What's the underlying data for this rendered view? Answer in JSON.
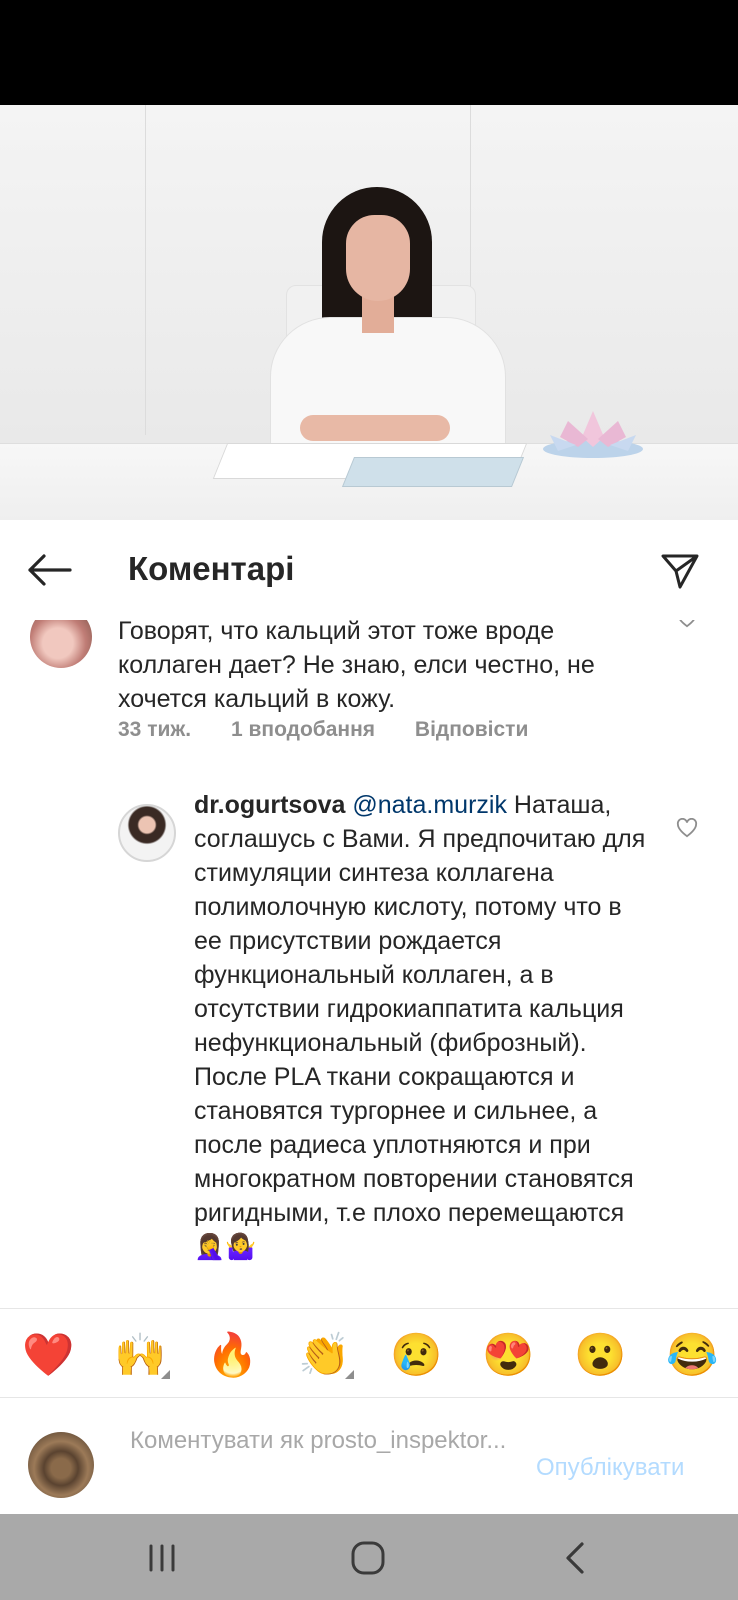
{
  "header": {
    "title": "Коментарі"
  },
  "comments": [
    {
      "text": "Говорят, что кальций этот тоже вроде коллаген дает? Не знаю, елси честно, не хочется кальций в кожу.",
      "time": "33 тиж.",
      "likes": "1 вподобання",
      "reply_label": "Відповісти"
    }
  ],
  "reply": {
    "username": "dr.ogurtsova",
    "mention": "@nata.murzik",
    "text": "Наташа, соглашусь с Вами. Я предпочитаю для стимуляции синтеза коллагена полимолочную кислоту, потому что в ее присутствии рождается функциональный коллаген, а в отсутствии гидрокиаппатита кальция нефункциональный (фиброзный). После PLA ткани сокращаются и становятся тургорнее и сильнее, а после радиеса уплотняются и при многократном повторении становятся ригидными, т.е плохо перемещаются🤦‍♀️🤷‍♀️"
  },
  "emoji_bar": [
    "❤️",
    "🙌",
    "🔥",
    "👏",
    "😢",
    "😍",
    "😮",
    "😂"
  ],
  "compose": {
    "placeholder": "Коментувати як prosto_inspektor...",
    "publish_label": "Опублікувати"
  },
  "colors": {
    "mention": "#00376b",
    "publish_disabled": "#b3dbff",
    "meta_gray": "#8e8e8e",
    "nav_bar": "#a9a9a9"
  }
}
